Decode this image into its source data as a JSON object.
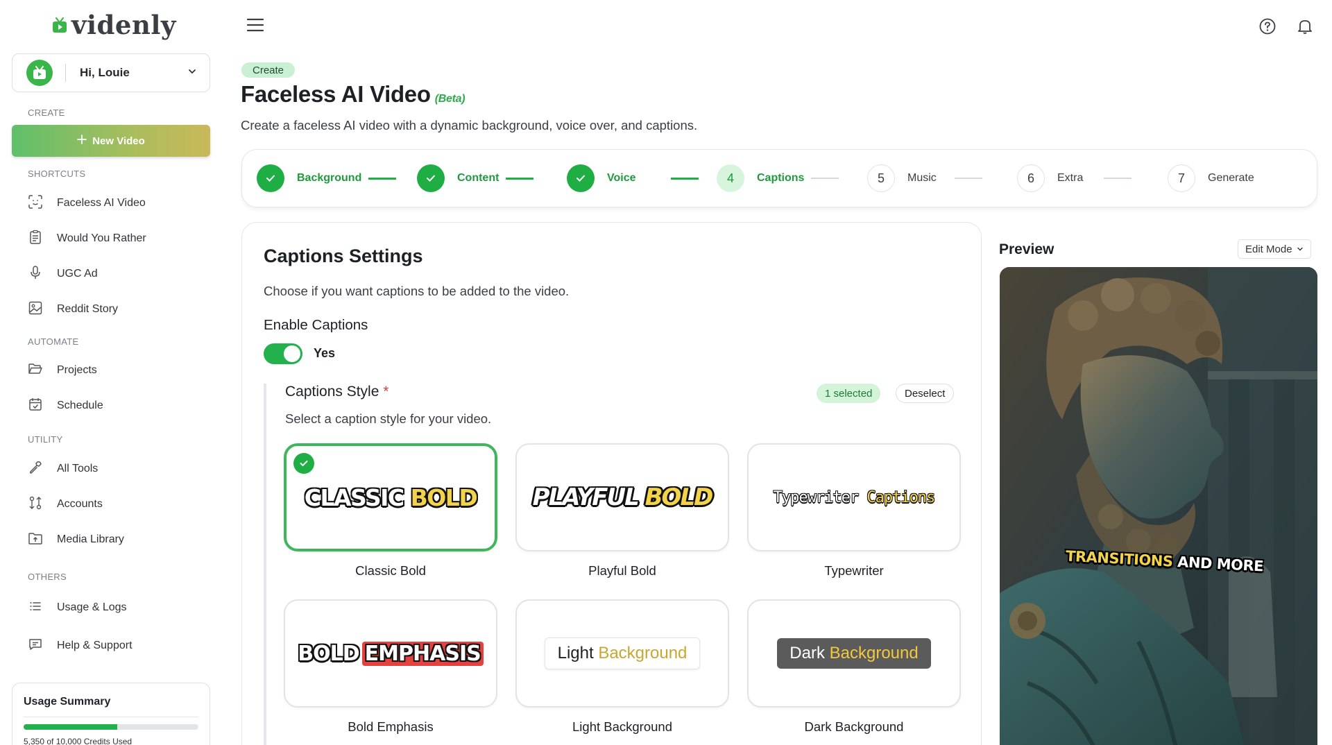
{
  "brand": {
    "name": "videnly"
  },
  "user": {
    "greeting": "Hi, Louie"
  },
  "sidebar": {
    "sections": {
      "create": "CREATE",
      "shortcuts": "SHORTCUTS",
      "automate": "AUTOMATE",
      "utility": "UTILITY",
      "others": "OTHERS"
    },
    "new_video": "New Video",
    "shortcuts": [
      "Faceless AI Video",
      "Would You Rather",
      "UGC Ad",
      "Reddit Story"
    ],
    "automate": [
      "Projects",
      "Schedule"
    ],
    "utility": [
      "All Tools",
      "Accounts",
      "Media Library"
    ],
    "others": [
      "Usage & Logs",
      "Help & Support"
    ]
  },
  "usage": {
    "title": "Usage Summary",
    "text": "5,350 of 10,000 Credits Used",
    "used": 5350,
    "total": 10000
  },
  "header": {
    "badge": "Create",
    "title": "Faceless AI Video",
    "beta": "(Beta)",
    "subtitle": "Create a faceless AI video with a dynamic background, voice over, and captions."
  },
  "stepper": {
    "steps": [
      {
        "num": "1",
        "label": "Background",
        "state": "done"
      },
      {
        "num": "2",
        "label": "Content",
        "state": "done"
      },
      {
        "num": "3",
        "label": "Voice",
        "state": "done"
      },
      {
        "num": "4",
        "label": "Captions",
        "state": "active"
      },
      {
        "num": "5",
        "label": "Music",
        "state": "todo"
      },
      {
        "num": "6",
        "label": "Extra",
        "state": "todo"
      },
      {
        "num": "7",
        "label": "Generate",
        "state": "todo"
      }
    ]
  },
  "captions": {
    "title": "Captions Settings",
    "subtitle": "Choose if you want captions to be added to the video.",
    "enable_label": "Enable Captions",
    "toggle_value": "Yes",
    "style_title": "Captions Style",
    "required_mark": "*",
    "style_subtitle": "Select a caption style for your video.",
    "selected_count": "1 selected",
    "deselect": "Deselect",
    "styles": [
      {
        "label": "Classic Bold",
        "sample_a": "CLASSIC",
        "sample_b": "BOLD",
        "selected": true
      },
      {
        "label": "Playful Bold",
        "sample_a": "PLAYFUL",
        "sample_b": "BOLD",
        "selected": false
      },
      {
        "label": "Typewriter",
        "sample_a": "Typewriter",
        "sample_b": "Captions",
        "selected": false
      },
      {
        "label": "Bold Emphasis",
        "sample_a": "BOLD",
        "sample_b": "EMPHASIS",
        "selected": false
      },
      {
        "label": "Light Background",
        "sample_a": "Light",
        "sample_b": "Background",
        "selected": false
      },
      {
        "label": "Dark Background",
        "sample_a": "Dark",
        "sample_b": "Background",
        "selected": false
      }
    ]
  },
  "preview": {
    "title": "Preview",
    "mode": "Edit Mode",
    "caption_a": "TRANSITIONS",
    "caption_b": "AND",
    "caption_c": "MORE"
  },
  "colors": {
    "accent": "#1fae44",
    "accent_light": "#d4f4da",
    "caption_yellow": "#f3d34a",
    "emphasis_red": "#e4413f"
  }
}
